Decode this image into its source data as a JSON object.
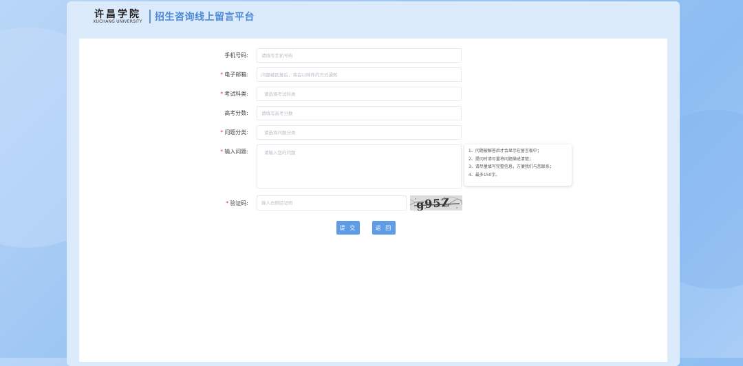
{
  "header": {
    "logo_cn": "许昌学院",
    "logo_en": "XUCHANG UNIVERSITY",
    "title": "招生咨询线上留言平台"
  },
  "form": {
    "phone": {
      "label": "手机号码:",
      "required": false,
      "placeholder": "请填写手机号码",
      "value": ""
    },
    "email": {
      "label": "电子邮箱:",
      "required": true,
      "placeholder": "问题被回复后，将会以邮件的方式通知",
      "value": ""
    },
    "exam_subject": {
      "label": "考试科类:",
      "required": true,
      "placeholder": "请选择考试科类",
      "value": ""
    },
    "score": {
      "label": "高考分数:",
      "required": false,
      "placeholder": "请填写高考分数",
      "value": ""
    },
    "category": {
      "label": "问题分类:",
      "required": true,
      "placeholder": "请选择问题分类",
      "value": ""
    },
    "question": {
      "label": "输入问题:",
      "required": true,
      "placeholder": "请输入您的问题",
      "value": ""
    },
    "captcha": {
      "label": "验证码:",
      "required": true,
      "placeholder": "输入右侧验证码",
      "value": "",
      "image_text": "g95Z"
    },
    "required_mark": "*"
  },
  "tips": [
    "1、问题被解答后才会显示在留言板中；",
    "2、提问时请尽量将问题描述清楚；",
    "3、请尽量填写完整信息，方便我们与您联系；",
    "4、最多150字。"
  ],
  "buttons": {
    "submit": "提 交",
    "back": "返 回"
  },
  "colors": {
    "accent": "#5e9ce8",
    "title": "#4d8ad7",
    "required": "#e3423c",
    "frame": "#dcebfb"
  }
}
